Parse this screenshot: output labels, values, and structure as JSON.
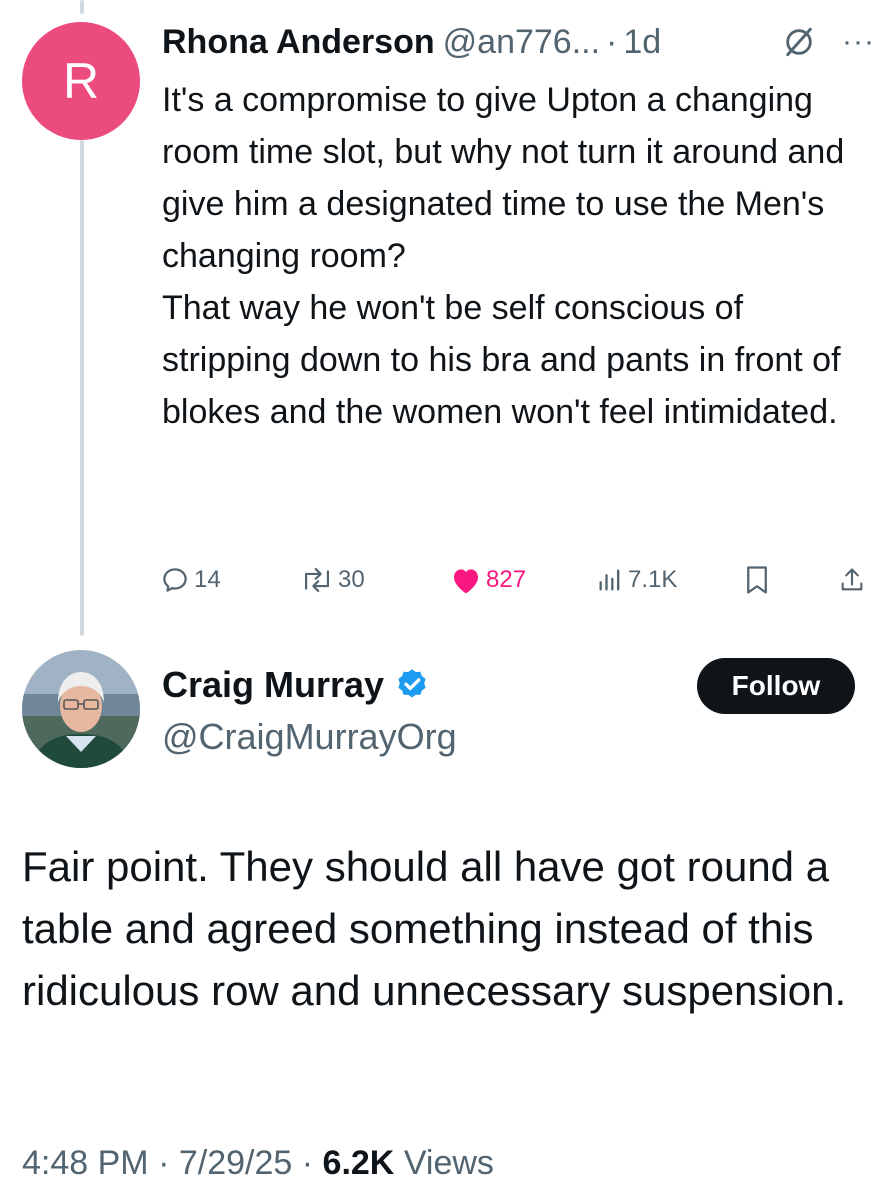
{
  "reply": {
    "avatar_initial": "R",
    "author_name": "Rhona Anderson",
    "handle": "@an776...",
    "separator": "·",
    "age": "1d",
    "paragraphs": [
      "It's a compromise to give Upton a changing room time slot, but why not turn it around and give him a designated time to use the Men's changing room?",
      "That way he won't be self conscious of stripping down to his bra and pants in front of blokes and the women won't feel intimidated."
    ],
    "replies_count": "14",
    "reposts_count": "30",
    "likes_count": "827",
    "views_count": "7.1K",
    "colors": {
      "avatar": "#ec4b7e",
      "like": "#f91880",
      "muted": "#536471"
    }
  },
  "main": {
    "author_name": "Craig Murray",
    "handle": "@CraigMurrayOrg",
    "follow_label": "Follow",
    "text": "Fair point. They should all have got round a table and agreed something instead of this ridiculous row and unnecessary suspension.",
    "time": "4:48 PM",
    "date": "7/29/25",
    "sep": "·",
    "views_count": "6.2K",
    "views_label": "Views",
    "colors": {
      "verified": "#1d9bf0",
      "button": "#0f1419"
    }
  },
  "icons": [
    "grok-icon",
    "more-icon",
    "reply-icon",
    "repost-icon",
    "like-icon",
    "views-icon",
    "bookmark-icon",
    "share-icon",
    "verified-badge-icon"
  ]
}
